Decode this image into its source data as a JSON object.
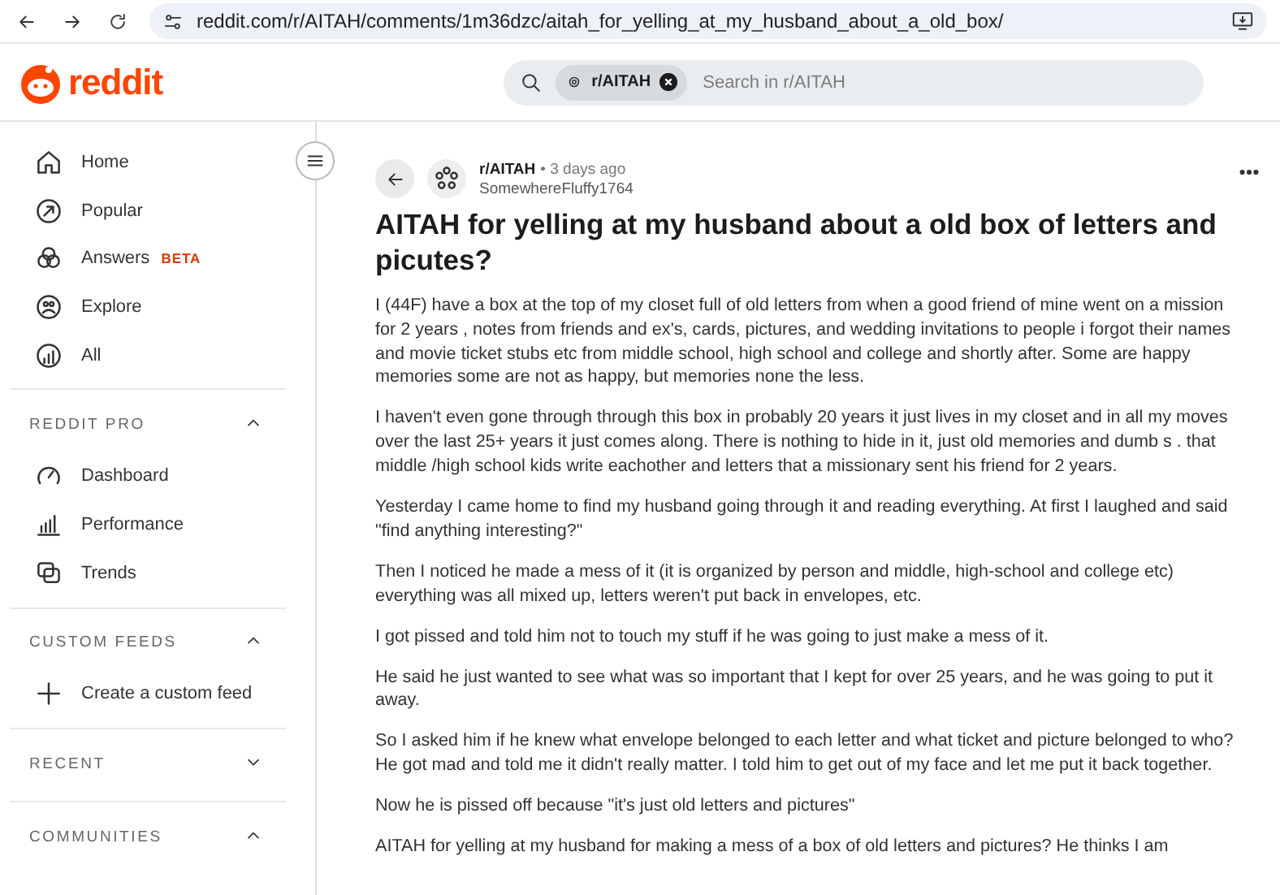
{
  "browser": {
    "url": "reddit.com/r/AITAH/comments/1m36dzc/aitah_for_yelling_at_my_husband_about_a_old_box/"
  },
  "header": {
    "logo": "reddit",
    "search": {
      "chip": "r/AITAH",
      "placeholder": "Search in r/AITAH"
    }
  },
  "sidebar": {
    "items": [
      {
        "kind": "home",
        "label": "Home"
      },
      {
        "kind": "popular",
        "label": "Popular"
      },
      {
        "kind": "answers",
        "label": "Answers",
        "badge": "BETA"
      },
      {
        "kind": "explore",
        "label": "Explore"
      },
      {
        "kind": "all",
        "label": "All"
      }
    ],
    "sections": [
      {
        "title": "REDDIT PRO",
        "expanded": true,
        "items": [
          {
            "kind": "dashboard",
            "label": "Dashboard"
          },
          {
            "kind": "performance",
            "label": "Performance"
          },
          {
            "kind": "trends",
            "label": "Trends"
          }
        ]
      },
      {
        "title": "CUSTOM FEEDS",
        "expanded": true,
        "items": [
          {
            "kind": "plus",
            "label": "Create a custom feed"
          }
        ]
      },
      {
        "title": "RECENT",
        "expanded": false
      },
      {
        "title": "COMMUNITIES",
        "expanded": true
      }
    ]
  },
  "post": {
    "subreddit": "r/AITAH",
    "time": "• 3 days ago",
    "author": "SomewhereFluffy1764",
    "title": "AITAH for yelling at my husband about a old box of letters and picutes?",
    "paragraphs": [
      "I (44F) have a box at the top of my closet full of old letters from when a good friend of mine went on a mission for 2 years , notes from friends and ex's, cards, pictures, and wedding invitations to people i forgot their names and movie ticket stubs etc from middle school, high school and college and shortly after. Some are happy memories some are not as happy, but memories none the less.",
      "I haven't even gone through through this box in probably 20 years it just lives in my closet and in all my moves over the last 25+ years it just comes along. There is nothing to hide in it, just old memories and dumb s . that middle /high school kids write eachother and letters that a missionary sent his friend for 2 years.",
      "Yesterday I came home to find my husband going through it and reading everything. At first I laughed and said \"find anything interesting?\"",
      "Then I noticed he made a mess of it (it is organized by person and middle, high-school and college etc) everything was all mixed up, letters weren't put back in envelopes, etc.",
      "I got pissed and told him not to touch my stuff if he was going to just make a mess of it.",
      "He said he just wanted to see what was so important that I kept for over 25 years, and he was going to put it away.",
      "So I asked him if he knew what envelope belonged to each letter and what ticket and picture belonged to who? He got mad and told me it didn't really matter. I told him to get out of my face and let me put it back together.",
      "Now he is pissed off because \"it's just old letters and pictures\"",
      "AITAH for yelling at my husband for making a mess of a box of old letters and pictures? He thinks I am"
    ]
  }
}
